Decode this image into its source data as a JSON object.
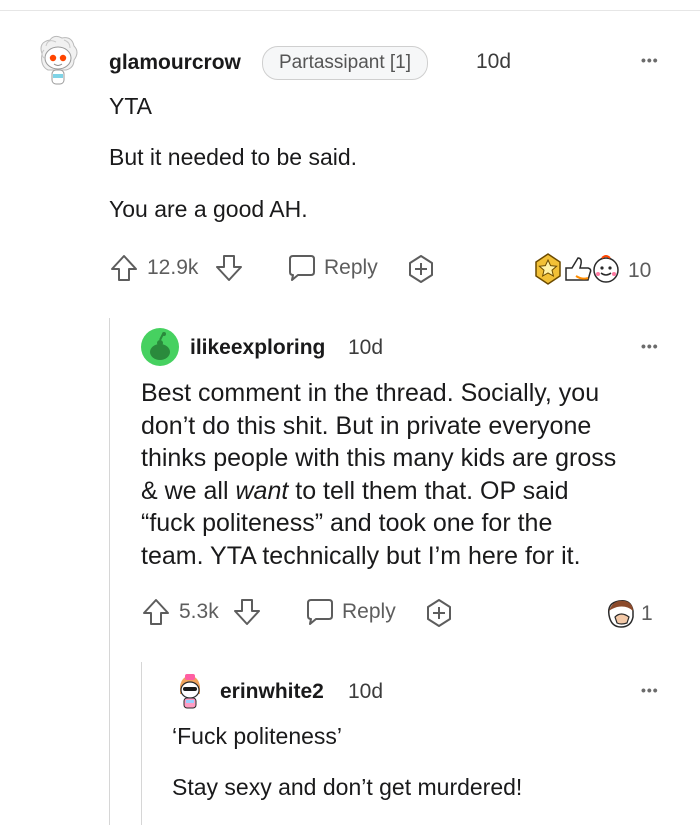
{
  "comments": [
    {
      "username": "glamourcrow",
      "flair": "Partassipant [1]",
      "time": "10d",
      "paragraphs": [
        "YTA",
        "But it needed to be said.",
        "You are a good AH."
      ],
      "upvotes": "12.9k",
      "reply_label": "Reply",
      "awards_count": "10",
      "more_label": "•••"
    },
    {
      "username": "ilikeexploring",
      "time": "10d",
      "body_lines": [
        "Best comment in the thread. Socially, you",
        "don’t do this shit. But in private everyone",
        "thinks people with this many kids are gross",
        "& we all ",
        "want",
        " to tell them that. OP said",
        "“fuck politeness” and took one for the",
        "team. YTA technically but I’m here for it."
      ],
      "upvotes": "5.3k",
      "reply_label": "Reply",
      "awards_count": "1",
      "more_label": "•••"
    },
    {
      "username": "erinwhite2",
      "time": "10d",
      "paragraphs": [
        "‘Fuck politeness’",
        "Stay sexy and don’t get murdered!"
      ],
      "more_label": "•••"
    }
  ],
  "colors": {
    "text": "#1a1a1b",
    "muted": "#5d5d5d",
    "avatar_green": "#46d160",
    "award_gold": "#f2c036"
  }
}
